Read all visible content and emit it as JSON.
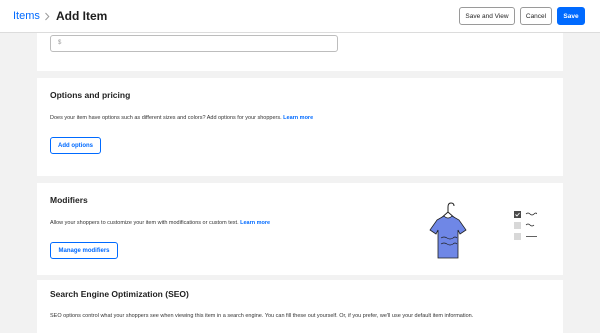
{
  "header": {
    "breadcrumb_link": "Items",
    "title": "Add Item",
    "save_and_view_label": "Save and View",
    "cancel_label": "Cancel",
    "save_label": "Save"
  },
  "price": {
    "prefix": "$"
  },
  "options": {
    "title": "Options and pricing",
    "description": "Does your item have options such as different sizes and colors? Add options for your shoppers.",
    "learn_more": "Learn more",
    "button_label": "Add options"
  },
  "modifiers": {
    "title": "Modifiers",
    "description": "Allow your shoppers to customize your item with modifications or custom text.",
    "learn_more": "Learn more",
    "button_label": "Manage modifiers"
  },
  "seo": {
    "title": "Search Engine Optimization (SEO)",
    "description": "SEO options control what your shoppers see when viewing this item in a search engine. You can fill these out yourself. Or, if you prefer, we'll use your default item information."
  },
  "colors": {
    "accent": "#006aff",
    "background": "#f2f2f2",
    "shirt": "#6f87e6"
  },
  "icons": [
    "chevron-right-icon",
    "tshirt-illustration",
    "checkbox-checked-icon"
  ]
}
